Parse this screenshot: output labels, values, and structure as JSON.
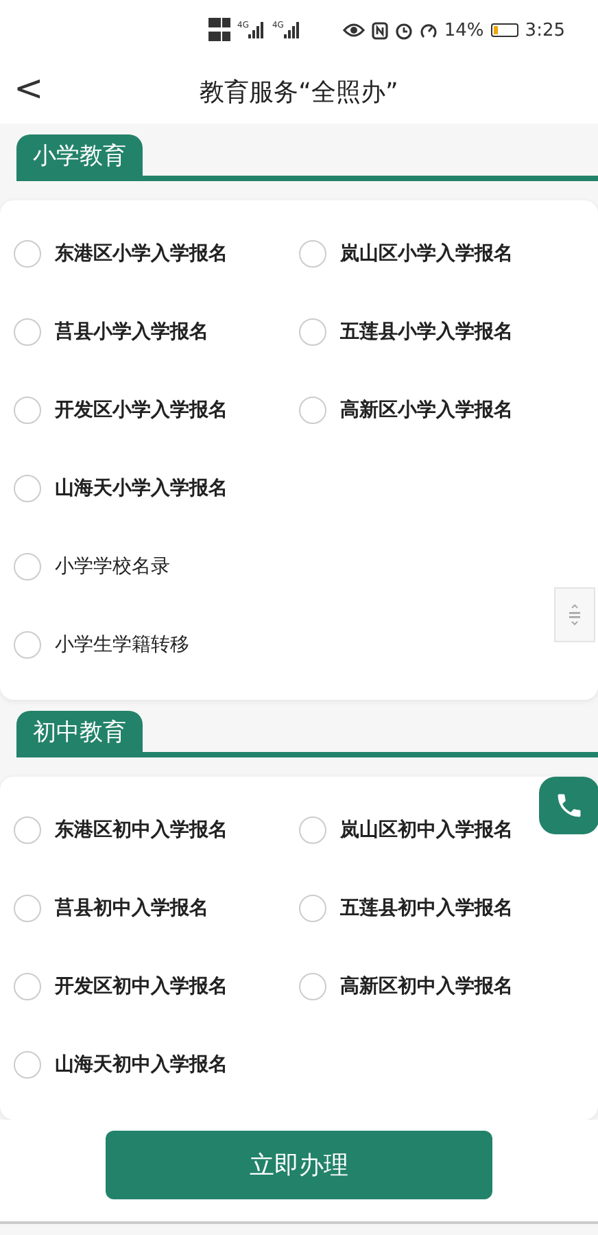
{
  "status_bar": {
    "network_labels": [
      "4G",
      "4G"
    ],
    "battery_percent": "14%",
    "time": "3:25"
  },
  "header": {
    "back": "<",
    "title": "教育服务“全照办”"
  },
  "sections": [
    {
      "title": "小学教育",
      "items": [
        {
          "label": "东港区小学入学报名",
          "kind": "register",
          "selected": false
        },
        {
          "label": "岚山区小学入学报名",
          "kind": "register",
          "selected": false
        },
        {
          "label": "莒县小学入学报名",
          "kind": "register",
          "selected": false
        },
        {
          "label": "五莲县小学入学报名",
          "kind": "register",
          "selected": false
        },
        {
          "label": "开发区小学入学报名",
          "kind": "register",
          "selected": false
        },
        {
          "label": "高新区小学入学报名",
          "kind": "register",
          "selected": false
        },
        {
          "label": "山海天小学入学报名",
          "kind": "register",
          "selected": false
        },
        {
          "label": "小学学校名录",
          "kind": "service",
          "selected": false
        },
        {
          "label": "小学生学籍转移",
          "kind": "service",
          "selected": false
        }
      ]
    },
    {
      "title": "初中教育",
      "items": [
        {
          "label": "东港区初中入学报名",
          "kind": "register",
          "selected": false
        },
        {
          "label": "岚山区初中入学报名",
          "kind": "register",
          "selected": false
        },
        {
          "label": "莒县初中入学报名",
          "kind": "register",
          "selected": false
        },
        {
          "label": "五莲县初中入学报名",
          "kind": "register",
          "selected": false
        },
        {
          "label": "开发区初中入学报名",
          "kind": "register",
          "selected": false
        },
        {
          "label": "高新区初中入学报名",
          "kind": "register",
          "selected": false
        },
        {
          "label": "山海天初中入学报名",
          "kind": "register",
          "selected": false
        }
      ]
    }
  ],
  "submit_button": "立即办理"
}
